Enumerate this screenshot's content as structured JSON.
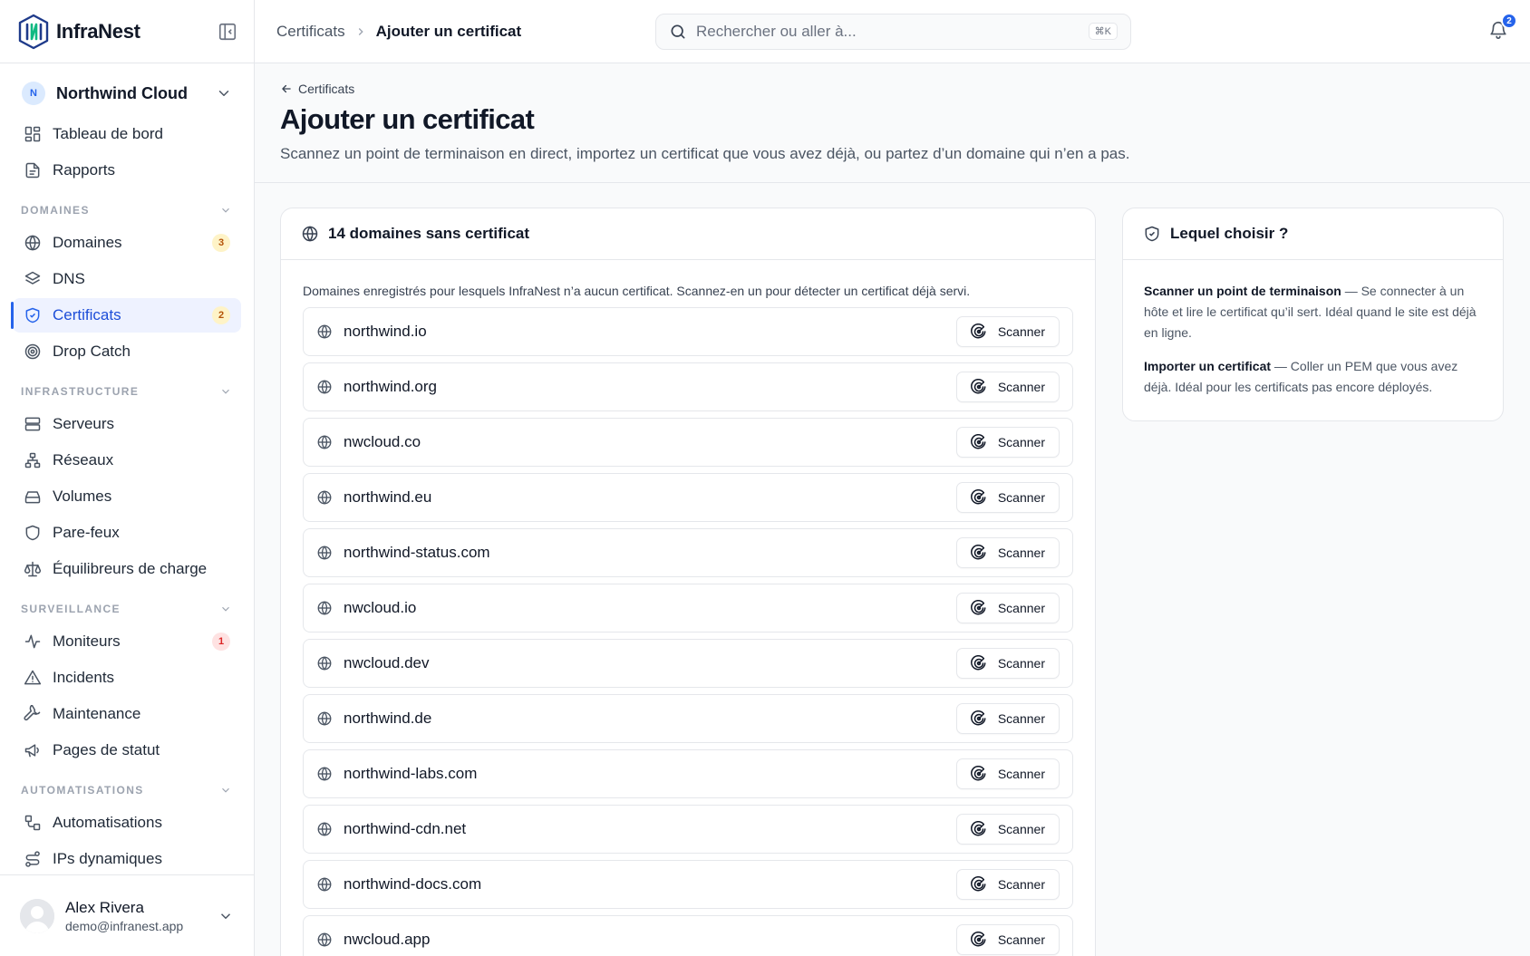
{
  "brand": {
    "name": "InfraNest"
  },
  "org": {
    "initial": "N",
    "name": "Northwind Cloud"
  },
  "nav": {
    "top": [
      {
        "label": "Tableau de bord",
        "icon": "dashboard-icon"
      },
      {
        "label": "Rapports",
        "icon": "report-icon"
      }
    ],
    "sections": [
      {
        "title": "DOMAINES",
        "items": [
          {
            "label": "Domaines",
            "icon": "globe-icon",
            "badge": "3",
            "badge_color": "amber"
          },
          {
            "label": "DNS",
            "icon": "layers-icon"
          },
          {
            "label": "Certificats",
            "icon": "shield-check-icon",
            "badge": "2",
            "badge_color": "amber",
            "active": true
          },
          {
            "label": "Drop Catch",
            "icon": "target-icon"
          }
        ]
      },
      {
        "title": "INFRASTRUCTURE",
        "items": [
          {
            "label": "Serveurs",
            "icon": "server-icon"
          },
          {
            "label": "Réseaux",
            "icon": "network-icon"
          },
          {
            "label": "Volumes",
            "icon": "drive-icon"
          },
          {
            "label": "Pare-feux",
            "icon": "shield-icon"
          },
          {
            "label": "Équilibreurs de charge",
            "icon": "scale-icon"
          }
        ]
      },
      {
        "title": "SURVEILLANCE",
        "items": [
          {
            "label": "Moniteurs",
            "icon": "activity-icon",
            "badge": "1",
            "badge_color": "red"
          },
          {
            "label": "Incidents",
            "icon": "warning-icon"
          },
          {
            "label": "Maintenance",
            "icon": "wrench-icon"
          },
          {
            "label": "Pages de statut",
            "icon": "megaphone-icon"
          }
        ]
      },
      {
        "title": "AUTOMATISATIONS",
        "items": [
          {
            "label": "Automatisations",
            "icon": "workflow-icon"
          },
          {
            "label": "IPs dynamiques",
            "icon": "route-icon"
          }
        ]
      }
    ]
  },
  "user": {
    "name": "Alex Rivera",
    "email": "demo@infranest.app"
  },
  "topbar": {
    "crumb_parent": "Certificats",
    "crumb_current": "Ajouter un certificat",
    "search_placeholder": "Rechercher ou aller à...",
    "search_shortcut": "⌘K",
    "notifications_count": "2"
  },
  "page": {
    "back_label": "Certificats",
    "title": "Ajouter un certificat",
    "description": "Scannez un point de terminaison en direct, importez un certificat que vous avez déjà, ou partez d’un domaine qui n’en a pas."
  },
  "domains_card": {
    "title": "14 domaines sans certificat",
    "intro": "Domaines enregistrés pour lesquels InfraNest n’a aucun certificat. Scannez-en un pour détecter un certificat déjà servi.",
    "scan_label": "Scanner",
    "domains": [
      "northwind.io",
      "northwind.org",
      "nwcloud.co",
      "northwind.eu",
      "northwind-status.com",
      "nwcloud.io",
      "nwcloud.dev",
      "northwind.de",
      "northwind-labs.com",
      "northwind-cdn.net",
      "northwind-docs.com",
      "nwcloud.app"
    ]
  },
  "help_card": {
    "title": "Lequel choisir ?",
    "items": [
      {
        "term": "Scanner un point de terminaison",
        "text": " — Se connecter à un hôte et lire le certificat qu’il sert. Idéal quand le site est déjà en ligne."
      },
      {
        "term": "Importer un certificat",
        "text": " — Coller un PEM que vous avez déjà. Idéal pour les certificats pas encore déployés."
      }
    ]
  }
}
